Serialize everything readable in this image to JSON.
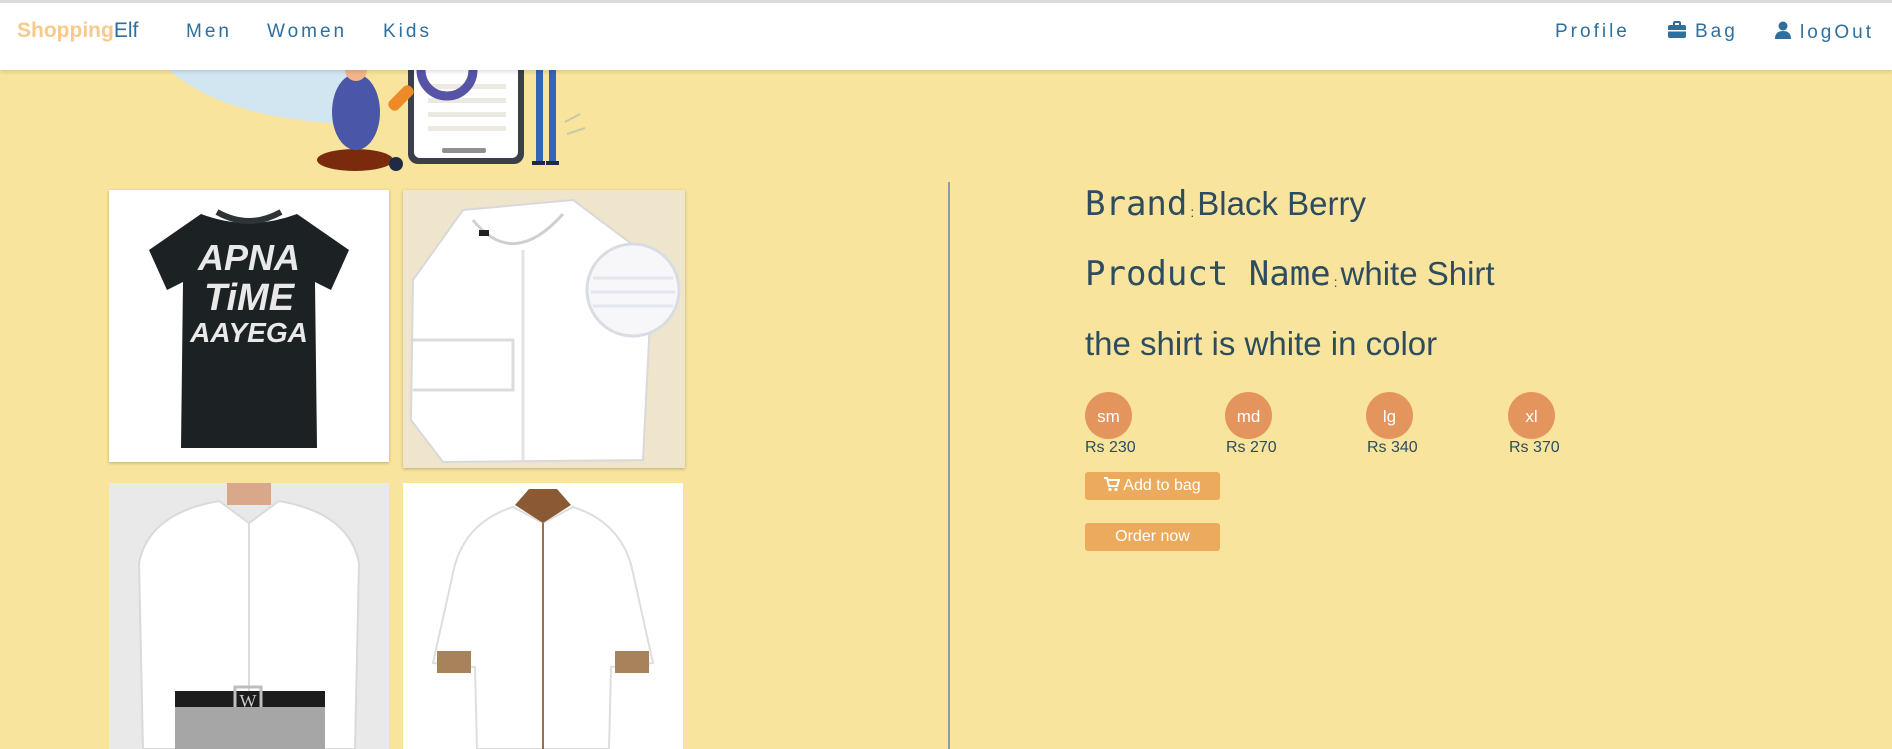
{
  "brand": {
    "part1": "Shopping",
    "part2": "Elf"
  },
  "nav": {
    "men": "Men",
    "women": "Women",
    "kids": "Kids",
    "profile": "Profile",
    "bag": "Bag",
    "logout": "logOut"
  },
  "gallery": {
    "tshirt_text": [
      "APNA",
      "TiME",
      "AAYEGA"
    ],
    "shirt_logo_letter": "W"
  },
  "product": {
    "brand_label": "Brand",
    "brand_value": "Black Berry",
    "name_label": "Product Name",
    "name_value": "white Shirt",
    "description": "the shirt is white in color"
  },
  "sizes": [
    {
      "label": "sm",
      "price": "Rs 230"
    },
    {
      "label": "md",
      "price": "Rs 270"
    },
    {
      "label": "lg",
      "price": "Rs 340"
    },
    {
      "label": "xl",
      "price": "Rs 370"
    }
  ],
  "actions": {
    "add_to_bag": "Add to bag",
    "order_now": "Order now"
  },
  "colors": {
    "page_background": "#f8e49c",
    "nav_link": "#2e6f9e",
    "brand_accent": "#f7c98b",
    "size_bubble": "#e4945d",
    "button": "#ecaa5d",
    "detail_text": "#2d4d5f"
  },
  "icons": {
    "bag": "briefcase-icon",
    "logout": "user-icon",
    "add_to_bag": "cart-icon"
  }
}
